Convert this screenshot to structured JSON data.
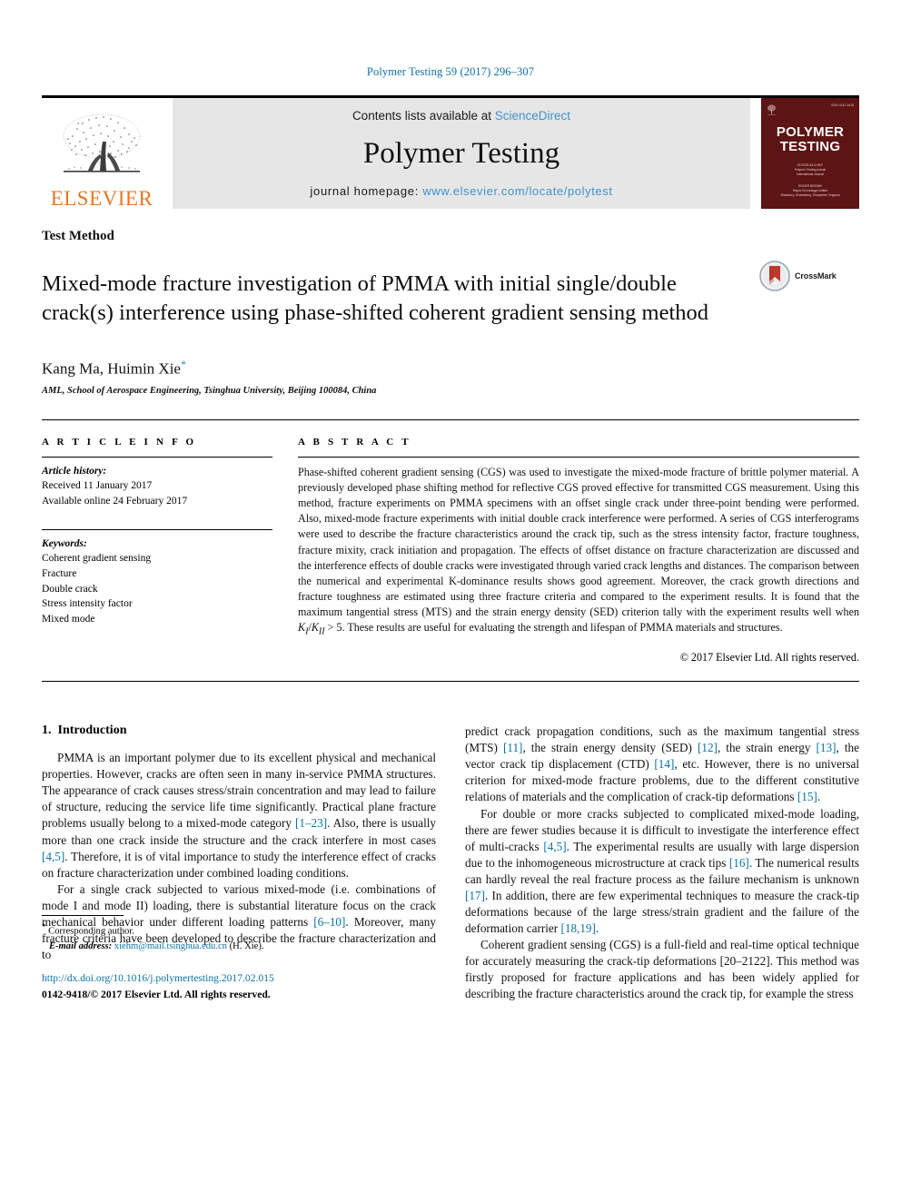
{
  "running_head": "Polymer Testing 59 (2017) 296–307",
  "masthead": {
    "publisher_name": "ELSEVIER",
    "contents_prefix": "Contents lists available at ",
    "contents_link": "ScienceDirect",
    "journal_title": "Polymer Testing",
    "homepage_prefix": "journal homepage: ",
    "homepage_link": "www.elsevier.com/locate/polytest",
    "cover": {
      "title_line1": "POLYMER",
      "title_line2": "TESTING",
      "issn_text": "ISSN 0142-9418",
      "block1": "EDITOR-IN-CHIEF\nPolymer Testing journal\nInternational Journal",
      "block2": "ROGER BROWN\nRapra Technology Limited\nShawbury, Shrewsbury, Shropshire, England"
    }
  },
  "article": {
    "type": "Test Method",
    "title": "Mixed-mode fracture investigation of PMMA with initial single/double crack(s) interference using phase-shifted coherent gradient sensing method",
    "crossmark_label": "CrossMark",
    "authors": "Kang Ma, Huimin Xie",
    "author_star": "*",
    "affiliation": "AML, School of Aerospace Engineering, Tsinghua University, Beijing 100084, China"
  },
  "article_info": {
    "heading": "A R T I C L E  I N F O",
    "history_label": "Article history:",
    "history_lines": [
      "Received 11 January 2017",
      "Available online 24 February 2017"
    ],
    "keywords_label": "Keywords:",
    "keywords": [
      "Coherent gradient sensing",
      "Fracture",
      "Double crack",
      "Stress intensity factor",
      "Mixed mode"
    ]
  },
  "abstract": {
    "heading": "A B S T R A C T",
    "part1": "Phase-shifted coherent gradient sensing (CGS) was used to investigate the mixed-mode fracture of brittle polymer material. A previously developed phase shifting method for reflective CGS proved effective for transmitted CGS measurement. Using this method, fracture experiments on PMMA specimens with an offset single crack under three-point bending were performed. Also, mixed-mode fracture experiments with initial double crack interference were performed. A series of CGS interferograms were used to describe the fracture characteristics around the crack tip, such as the stress intensity factor, fracture toughness, fracture mixity, crack initiation and propagation. The effects of offset distance on fracture characterization are discussed and the interference effects of double cracks were investigated through varied crack lengths and distances. The comparison between the numerical and experimental K-dominance results shows good agreement. Moreover, the crack growth directions and fracture toughness are estimated using three fracture criteria and compared to the experiment results. It is found that the maximum tangential stress (MTS) and the strain energy density (SED) criterion tally with the experiment results well when ",
    "formula": "K₁/K₁₁ > 5",
    "formula_italic_k1": "K",
    "formula_sub1": "I",
    "formula_sep": "/",
    "formula_italic_k2": "K",
    "formula_sub2": "II",
    "formula_tail": " > 5",
    "part2": ". These results are useful for evaluating the strength and lifespan of PMMA materials and structures.",
    "copyright": "© 2017 Elsevier Ltd. All rights reserved."
  },
  "intro": {
    "number": "1.",
    "heading": "Introduction",
    "left": {
      "p1_a": "PMMA is an important polymer due to its excellent physical and mechanical properties. However, cracks are often seen in many in-service PMMA structures. The appearance of crack causes stress/strain concentration and may lead to failure of structure, reducing the service life time significantly. Practical plane fracture problems usually belong to a mixed-mode category ",
      "p1_ref1": "[1–23]",
      "p1_b": ". Also, there is usually more than one crack inside the structure and the crack interfere in most cases ",
      "p1_ref2": "[4,5]",
      "p1_c": ". Therefore, it is of vital importance to study the interference effect of cracks on fracture characterization under combined loading conditions.",
      "p2_a": "For a single crack subjected to various mixed-mode (i.e. combinations of mode I and mode II) loading, there is substantial literature focus on the crack mechanical behavior under different loading patterns ",
      "p2_ref1": "[6–10]",
      "p2_b": ". Moreover, many fracture criteria have been developed to describe the fracture characterization and to"
    },
    "right": {
      "p1_a": "predict crack propagation conditions, such as the maximum tangential stress (MTS) ",
      "p1_ref1": "[11]",
      "p1_b": ", the strain energy density (SED) ",
      "p1_ref2": "[12]",
      "p1_c": ", the strain energy ",
      "p1_ref3": "[13]",
      "p1_d": ", the vector crack tip displacement (CTD) ",
      "p1_ref4": "[14]",
      "p1_e": ", etc. However, there is no universal criterion for mixed-mode fracture problems, due to the different constitutive relations of materials and the complication of crack-tip deformations ",
      "p1_ref5": "[15]",
      "p1_f": ".",
      "p2_a": "For double or more cracks subjected to complicated mixed-mode loading, there are fewer studies because it is difficult to investigate the interference effect of multi-cracks ",
      "p2_ref1": "[4,5]",
      "p2_b": ". The experimental results are usually with large dispersion due to the inhomogeneous microstructure at crack tips ",
      "p2_ref2": "[16]",
      "p2_c": ". The numerical results can hardly reveal the real fracture process as the failure mechanism is unknown ",
      "p2_ref3": "[17]",
      "p2_d": ". In addition, there are few experimental techniques to measure the crack-tip deformations because of the large stress/strain gradient and the failure of the deformation carrier ",
      "p2_ref4": "[18,19]",
      "p2_e": ".",
      "p3_a": "Coherent gradient sensing (CGS) is a full-field and real-time optical technique for accurately measuring the crack-tip deformations ",
      "p3_ref1": "[20–2122]",
      "p3_b": ". This method was firstly proposed for fracture applications and has been widely applied for describing the fracture characteristics around the crack tip, for example the stress"
    }
  },
  "footnote": {
    "corresponding_star": "*",
    "corresponding_text": " Corresponding author.",
    "email_label": "E-mail address:",
    "email": "xiehm@mail.tsinghua.edu.cn",
    "email_suffix": " (H. Xie).",
    "doi": "http://dx.doi.org/10.1016/j.polymertesting.2017.02.015",
    "issn_copyright": "0142-9418/© 2017 Elsevier Ltd. All rights reserved."
  },
  "colors": {
    "link_blue": "#0b72a8",
    "sciencedirect_blue": "#3d93cf",
    "elsevier_orange": "#e87722",
    "cover_maroon": "#5c1414",
    "masthead_grey": "#e6e6e6"
  }
}
